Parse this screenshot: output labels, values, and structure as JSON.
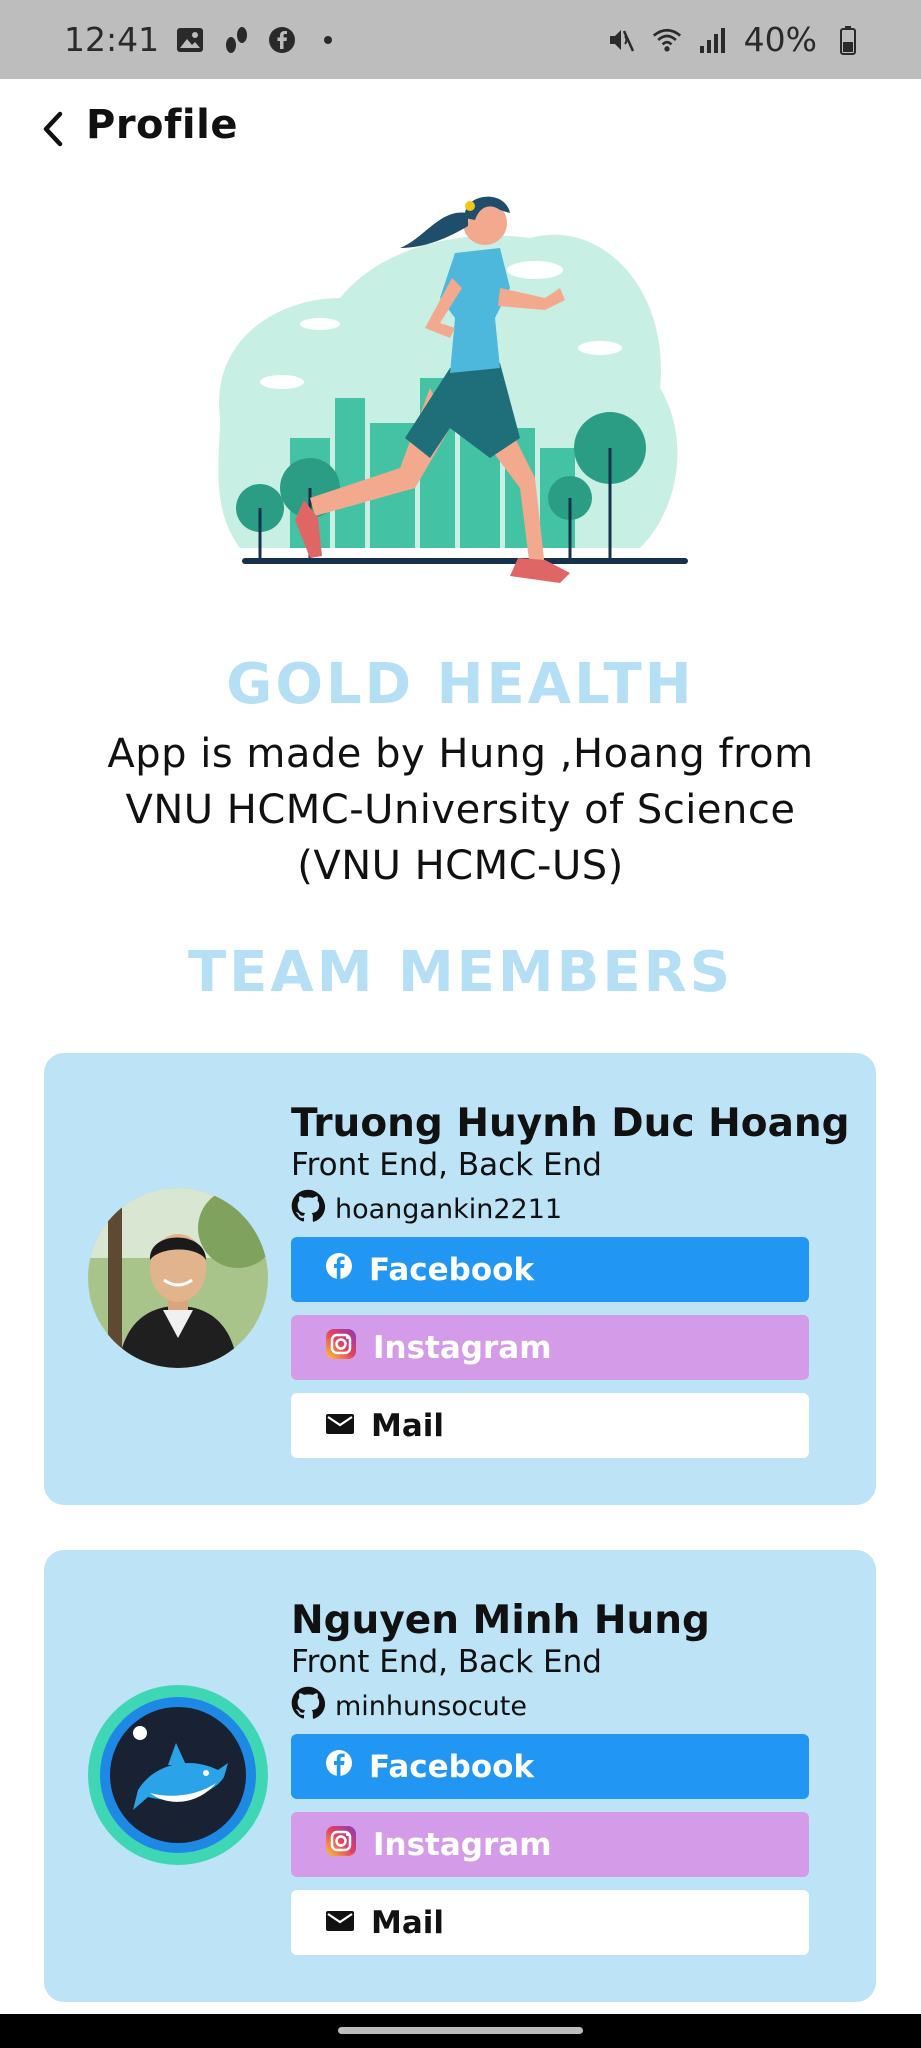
{
  "status_bar": {
    "time": "12:41",
    "battery": "40%",
    "left_icons": [
      "gallery-icon",
      "footsteps-icon",
      "facebook-notification-icon",
      "dot-icon"
    ],
    "right_icons": [
      "mute-icon",
      "wifi-icon",
      "signal-icon",
      "battery-icon"
    ]
  },
  "appbar": {
    "title": "Profile"
  },
  "app": {
    "name": "GOLD HEALTH",
    "description_lines": [
      "App is made by Hung ,Hoang from",
      "VNU HCMC-University of Science",
      "(VNU HCMC-US)"
    ]
  },
  "team": {
    "title": "TEAM MEMBERS",
    "members": [
      {
        "name": "Truong Huynh Duc Hoang",
        "role": "Front End, Back End",
        "github": "hoangankin2211",
        "buttons": {
          "facebook": "Facebook",
          "instagram": "Instagram",
          "mail": "Mail"
        }
      },
      {
        "name": "Nguyen Minh Hung",
        "role": "Front End, Back End",
        "github": "minhunsocute",
        "buttons": {
          "facebook": "Facebook",
          "instagram": "Instagram",
          "mail": "Mail"
        }
      }
    ]
  },
  "colors": {
    "accent_light_blue": "#b5dff5",
    "card_bg": "#bde3f6",
    "facebook_blue": "#2196f3",
    "instagram_purple": "#d49be9"
  }
}
